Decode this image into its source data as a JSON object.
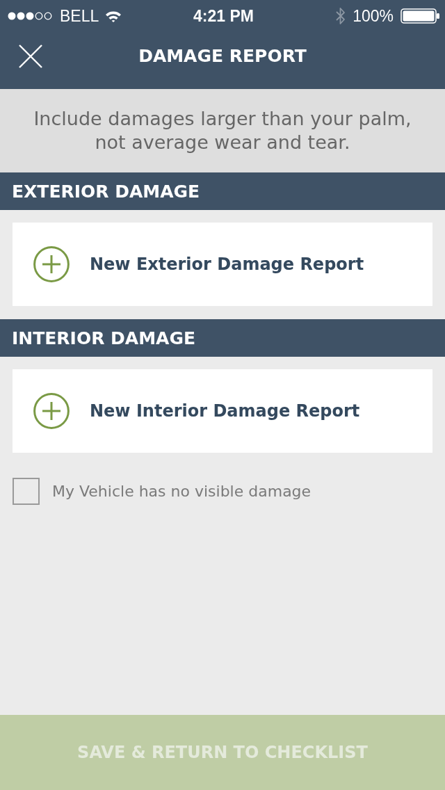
{
  "status_bar": {
    "carrier": "BELL",
    "time": "4:21 PM",
    "battery": "100%"
  },
  "nav_bar": {
    "title": "DAMAGE REPORT"
  },
  "hint": "Include damages larger than your palm, not average wear and tear.",
  "sections": [
    {
      "title": "EXTERIOR DAMAGE",
      "action": "New Exterior Damage Report"
    },
    {
      "title": "INTERIOR DAMAGE",
      "action": "New Interior Damage Report"
    }
  ],
  "no_damage_checkbox": {
    "label": "My Vehicle has no visible damage",
    "checked": false
  },
  "save_button": {
    "label": "SAVE & RETURN TO CHECKLIST",
    "disabled": true
  }
}
